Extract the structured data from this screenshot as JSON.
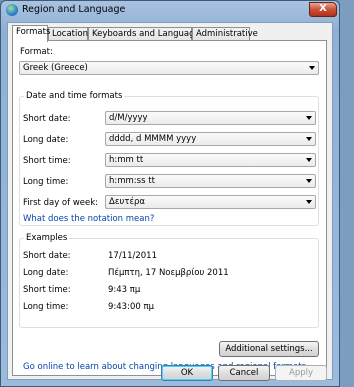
{
  "window": {
    "title": "Region and Language",
    "close_symbol": "X"
  },
  "tabs": [
    {
      "label": "Formats"
    },
    {
      "label": "Location"
    },
    {
      "label": "Keyboards and Languages"
    },
    {
      "label": "Administrative"
    }
  ],
  "format": {
    "label": "Format:",
    "value": "Greek (Greece)"
  },
  "date_time_group": {
    "title": "Date and time formats",
    "rows": [
      {
        "label": "Short date:",
        "value": "d/M/yyyy"
      },
      {
        "label": "Long date:",
        "value": "dddd, d MMMM yyyy"
      },
      {
        "label": "Short time:",
        "value": "h:mm tt"
      },
      {
        "label": "Long time:",
        "value": "h:mm:ss tt"
      },
      {
        "label": "First day of week:",
        "value": "Δευτέρα"
      }
    ],
    "notation_link": "What does the notation mean?"
  },
  "examples_group": {
    "title": "Examples",
    "rows": [
      {
        "label": "Short date:",
        "value": "17/11/2011"
      },
      {
        "label": "Long date:",
        "value": "Πέμπτη, 17 Νοεμβρίου 2011"
      },
      {
        "label": "Short time:",
        "value": "9:43 πμ"
      },
      {
        "label": "Long time:",
        "value": "9:43:00 πμ"
      }
    ]
  },
  "additional_settings": "Additional settings...",
  "online_link": "Go online to learn about changing languages and regional formats",
  "buttons": {
    "ok": "OK",
    "cancel": "Cancel",
    "apply": "Apply"
  }
}
